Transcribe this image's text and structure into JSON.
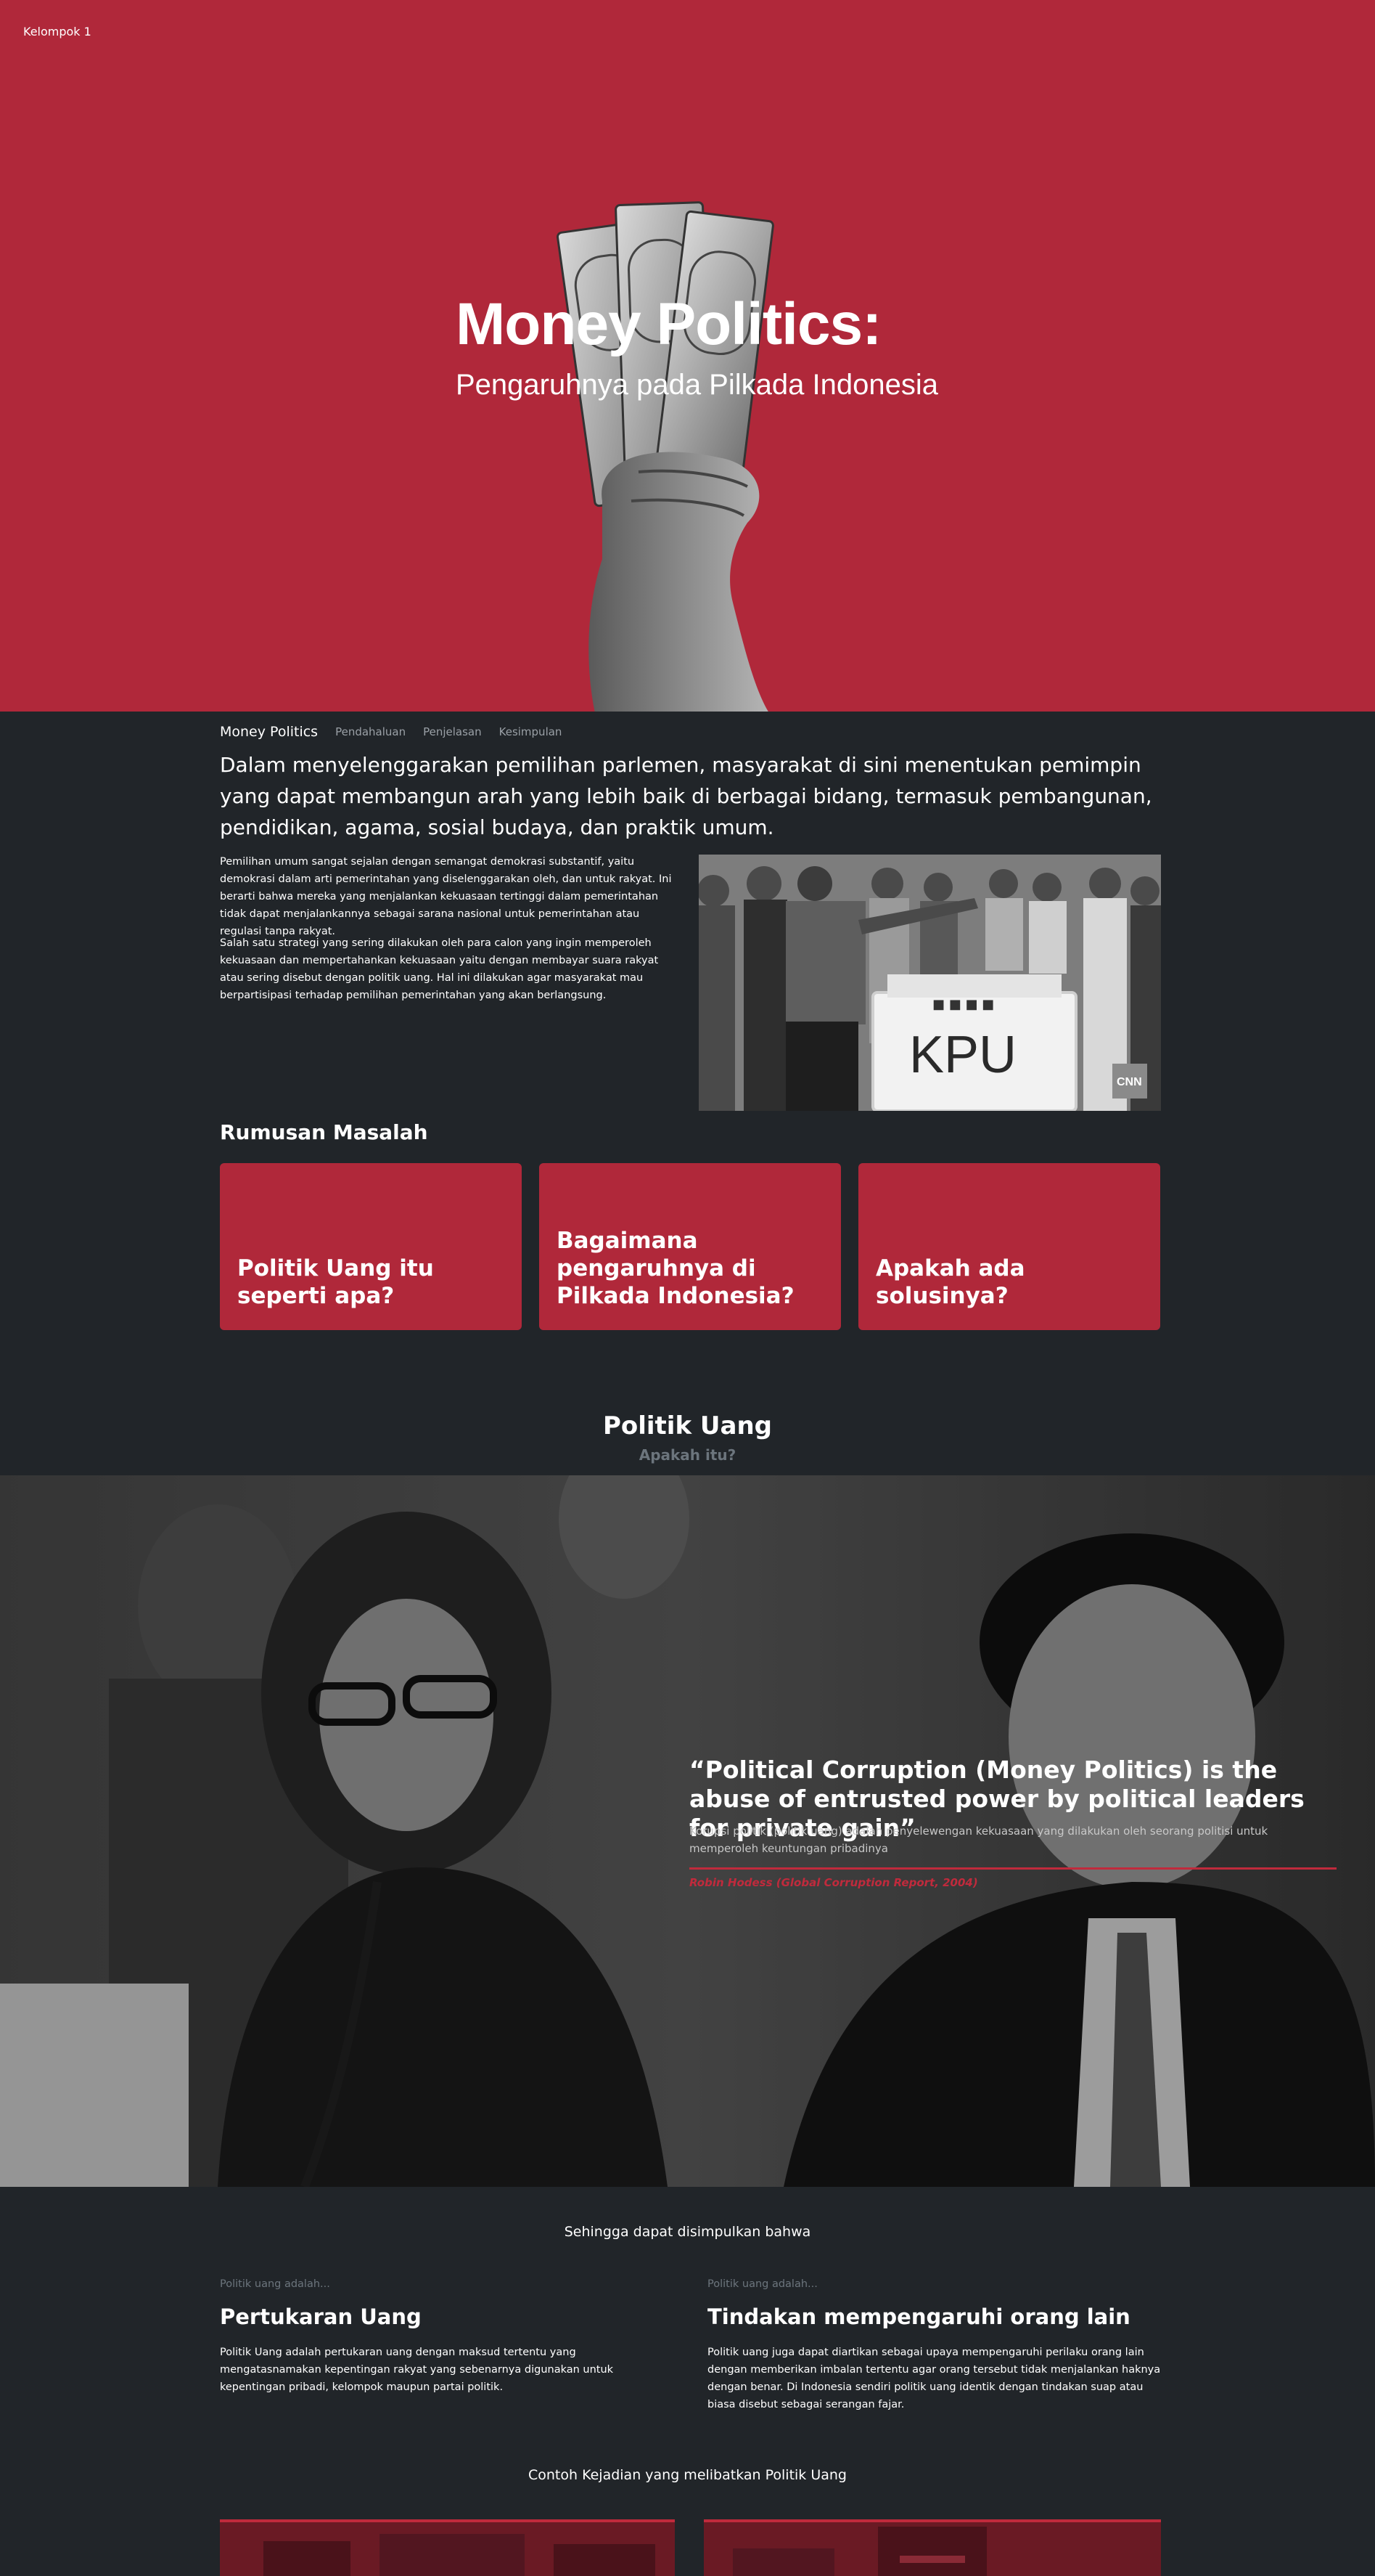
{
  "brand": "Kelompok 1",
  "hero": {
    "title": "Money Politics:",
    "subtitle": "Pengaruhnya pada Pilkada Indonesia"
  },
  "nav": {
    "brand": "Money Politics",
    "links": [
      "Pendahaluan",
      "Penjelasan",
      "Kesimpulan"
    ]
  },
  "lead": "Dalam menyelenggarakan pemilihan parlemen, masyarakat di sini menentukan pemimpin yang dapat membangun arah yang lebih baik di berbagai bidang, termasuk pembangunan, pendidikan, agama, sosial budaya, dan praktik umum.",
  "paragraphs": [
    "Pemilihan umum sangat sejalan dengan semangat demokrasi substantif, yaitu demokrasi dalam arti pemerintahan yang diselenggarakan oleh, dan untuk rakyat. Ini berarti bahwa mereka yang menjalankan kekuasaan tertinggi dalam pemerintahan tidak dapat menjalankannya sebagai sarana nasional untuk pemerintahan atau regulasi tanpa rakyat.",
    "Salah satu strategi yang sering dilakukan oleh para calon yang ingin memperoleh kekuasaan dan mempertahankan kekuasaan yaitu dengan membayar suara rakyat atau sering disebut dengan politik uang. Hal ini dilakukan agar masyarakat mau berpartisipasi terhadap pemilihan pemerintahan yang akan berlangsung."
  ],
  "image_kpu": {
    "box_label": "KPU",
    "watermark": "CNN"
  },
  "rumusan": {
    "title": "Rumusan Masalah",
    "cards": [
      "Politik Uang itu seperti apa?",
      "Bagaimana pengaruhnya di Pilkada Indonesia?",
      "Apakah ada solusinya?"
    ]
  },
  "politik_uang": {
    "title": "Politik Uang",
    "subtitle": "Apakah itu?"
  },
  "quote": {
    "text": "“Political Corruption (Money Politics) is the abuse of entrusted power by political leaders for private gain”",
    "translation": "Korupsi politik (politik uang) adalah penyelewengan kekuasaan yang dilakukan oleh seorang politisi untuk memperoleh keuntungan pribadinya",
    "source": "Robin Hodess (Global Corruption Report, 2004)"
  },
  "conclusion": {
    "title": "Sehingga dapat disimpulkan bahwa",
    "columns": [
      {
        "kicker": "Politik uang adalah...",
        "heading": "Pertukaran Uang",
        "body": "Politik Uang adalah pertukaran uang dengan maksud tertentu yang mengatasnamakan kepentingan rakyat yang sebenarnya digunakan untuk kepentingan pribadi, kelompok maupun partai politik."
      },
      {
        "kicker": "Politik uang adalah...",
        "heading": "Tindakan mempengaruhi orang lain",
        "body": "Politik uang juga dapat diartikan sebagai upaya mempengaruhi perilaku orang lain dengan memberikan imbalan tertentu agar orang tersebut tidak menjalankan haknya dengan benar. Di Indonesia sendiri politik uang identik dengan tindakan suap atau biasa disebut sebagai serangan fajar."
      }
    ]
  },
  "contoh": {
    "title": "Contoh Kejadian yang melibatkan Politik Uang"
  },
  "colors": {
    "accent": "#b0283a",
    "background": "#212529",
    "muted": "#6c757d"
  }
}
